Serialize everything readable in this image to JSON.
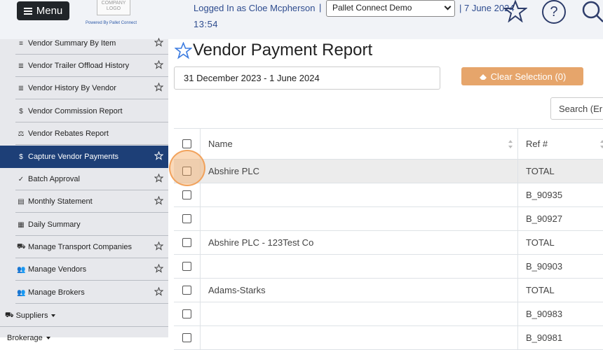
{
  "header": {
    "menu_label": "Menu",
    "logo_text": "COMPANY LOGO",
    "powered_by": "Powered By Pallet Connect",
    "logged_in": "Logged In as Cloe Mcpherson",
    "separator": "|",
    "company_selected": "Pallet Connect Demo",
    "date": "| 7 June 2024",
    "time": "13:54"
  },
  "sidebar": {
    "items": [
      {
        "icon": "≡",
        "label": "Vendor Summary By Item",
        "star": true,
        "active": false
      },
      {
        "icon": "≣",
        "label": "Vendor Trailer Offload History",
        "star": true,
        "active": false
      },
      {
        "icon": "≣",
        "label": "Vendor History By Vendor",
        "star": true,
        "active": false
      },
      {
        "icon": "$",
        "label": "Vendor Commission Report",
        "star": false,
        "active": false
      },
      {
        "icon": "⚖",
        "label": "Vendor Rebates Report",
        "star": false,
        "active": false
      },
      {
        "icon": "$",
        "label": "Capture Vendor Payments",
        "star": true,
        "active": true
      },
      {
        "icon": "✓",
        "label": "Batch Approval",
        "star": true,
        "active": false
      },
      {
        "icon": "▤",
        "label": "Monthly Statement",
        "star": true,
        "active": false
      },
      {
        "icon": "▦",
        "label": "Daily Summary",
        "star": false,
        "active": false
      },
      {
        "icon": "⛟",
        "label": "Manage Transport Companies",
        "star": true,
        "active": false
      },
      {
        "icon": "👥",
        "label": "Manage Vendors",
        "star": true,
        "active": false
      },
      {
        "icon": "👥",
        "label": "Manage Brokers",
        "star": true,
        "active": false
      }
    ],
    "categories": [
      {
        "icon": "⛟",
        "label": "Suppliers"
      },
      {
        "icon": "",
        "label": "Brokerage"
      }
    ]
  },
  "main": {
    "title": "Vendor Payment Report",
    "date_range": "31 December 2023 - 1 June 2024",
    "clear_selection": "Clear Selection (0)",
    "search_placeholder": "Search (Er",
    "columns": {
      "name": "Name",
      "ref": "Ref #"
    },
    "rows": [
      {
        "name": "Abshire PLC",
        "ref": "TOTAL"
      },
      {
        "name": "",
        "ref": "B_90935"
      },
      {
        "name": "",
        "ref": "B_90927"
      },
      {
        "name": "Abshire PLC - 123Test Co",
        "ref": "TOTAL"
      },
      {
        "name": "",
        "ref": "B_90903"
      },
      {
        "name": "Adams-Starks",
        "ref": "TOTAL"
      },
      {
        "name": "",
        "ref": "B_90983"
      },
      {
        "name": "",
        "ref": "B_90981"
      }
    ]
  },
  "colors": {
    "active_nav": "#1d3f77",
    "clear_button": "#e6a56b",
    "link_text": "#2e4c8f"
  }
}
